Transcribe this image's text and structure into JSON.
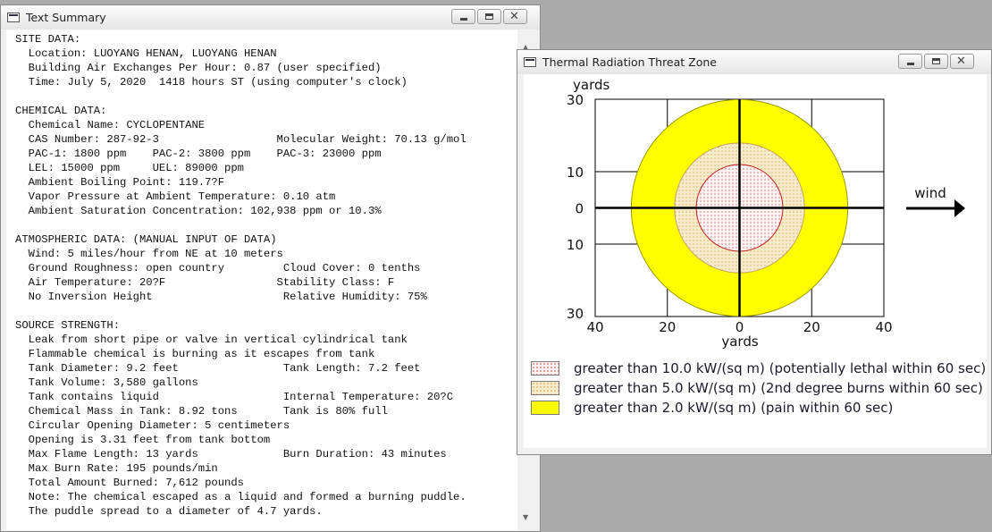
{
  "text_window": {
    "title": "Text Summary",
    "lines": [
      "SITE DATA:",
      "  Location: LUOYANG HENAN, LUOYANG HENAN",
      "  Building Air Exchanges Per Hour: 0.87 (user specified)",
      "  Time: July 5, 2020  1418 hours ST (using computer's clock)",
      "",
      "CHEMICAL DATA:",
      "  Chemical Name: CYCLOPENTANE",
      "  CAS Number: 287-92-3                  Molecular Weight: 70.13 g/mol",
      "  PAC-1: 1800 ppm    PAC-2: 3800 ppm    PAC-3: 23000 ppm",
      "  LEL: 15000 ppm     UEL: 89000 ppm",
      "  Ambient Boiling Point: 119.7?F",
      "  Vapor Pressure at Ambient Temperature: 0.10 atm",
      "  Ambient Saturation Concentration: 102,938 ppm or 10.3%",
      "",
      "ATMOSPHERIC DATA: (MANUAL INPUT OF DATA)",
      "  Wind: 5 miles/hour from NE at 10 meters",
      "  Ground Roughness: open country         Cloud Cover: 0 tenths",
      "  Air Temperature: 20?F                 Stability Class: F",
      "  No Inversion Height                    Relative Humidity: 75%",
      "",
      "SOURCE STRENGTH:",
      "  Leak from short pipe or valve in vertical cylindrical tank",
      "  Flammable chemical is burning as it escapes from tank",
      "  Tank Diameter: 9.2 feet                Tank Length: 7.2 feet",
      "  Tank Volume: 3,580 gallons",
      "  Tank contains liquid                   Internal Temperature: 20?C",
      "  Chemical Mass in Tank: 8.92 tons       Tank is 80% full",
      "  Circular Opening Diameter: 5 centimeters",
      "  Opening is 3.31 feet from tank bottom",
      "  Max Flame Length: 13 yards             Burn Duration: 43 minutes",
      "  Max Burn Rate: 195 pounds/min",
      "  Total Amount Burned: 7,612 pounds",
      "  Note: The chemical escaped as a liquid and formed a burning puddle.",
      "  The puddle spread to a diameter of 4.7 yards."
    ]
  },
  "thermal_window": {
    "title": "Thermal Radiation Threat Zone",
    "y_unit_label": "yards",
    "x_unit_label": "yards",
    "wind_label": "wind",
    "y_ticks": [
      {
        "value": 30,
        "label": "30"
      },
      {
        "value": 10,
        "label": "10"
      },
      {
        "value": 0,
        "label": "0"
      },
      {
        "value": -10,
        "label": "10"
      },
      {
        "value": -30,
        "label": "30"
      }
    ],
    "x_ticks": [
      {
        "value": -40,
        "label": "40"
      },
      {
        "value": -20,
        "label": "20"
      },
      {
        "value": 0,
        "label": "0"
      },
      {
        "value": 20,
        "label": "20"
      },
      {
        "value": 40,
        "label": "40"
      }
    ],
    "zones": [
      {
        "id": "yellow",
        "radius_yards": 30,
        "fill": "#ffff00",
        "stroke": "#9a9a00",
        "pattern": "none",
        "label": "greater than 2.0 kW/(sq m) (pain within 60 sec)"
      },
      {
        "id": "orange",
        "radius_yards": 18,
        "fill": "#f2e8c8",
        "stroke": "#c8a060",
        "pattern": "orange-dots",
        "label": "greater than 5.0 kW/(sq m) (2nd degree burns within 60 sec)"
      },
      {
        "id": "red",
        "radius_yards": 12,
        "fill": "#fdecec",
        "stroke": "#c02020",
        "pattern": "red-dots",
        "label": "greater than 10.0 kW/(sq m) (potentially lethal within 60 sec)"
      }
    ],
    "legend_order": [
      "red",
      "orange",
      "yellow"
    ]
  }
}
